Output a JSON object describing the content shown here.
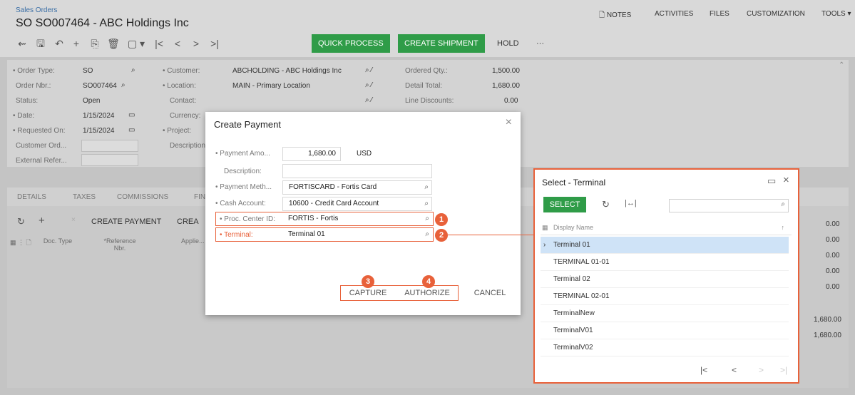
{
  "header": {
    "breadcrumb": "Sales Orders",
    "title": "SO SO007464 - ABC Holdings Inc",
    "nav": [
      "NOTES",
      "ACTIVITIES",
      "FILES",
      "CUSTOMIZATION",
      "TOOLS ▾"
    ],
    "toolbar_icons": [
      "back-icon",
      "save-icon",
      "undo-icon",
      "add-icon",
      "copy-icon",
      "delete-icon",
      "clipboard-icon",
      "first-icon",
      "prev-icon",
      "next-icon",
      "last-icon"
    ],
    "quick_process": "QUICK PROCESS",
    "create_shipment": "CREATE SHIPMENT",
    "hold": "HOLD",
    "more": "···"
  },
  "form": {
    "order_type_label": "Order Type:",
    "order_type": "SO",
    "order_nbr_label": "Order Nbr.:",
    "order_nbr": "SO007464",
    "status_label": "Status:",
    "status": "Open",
    "date_label": "Date:",
    "date": "1/15/2024",
    "requested_on_label": "Requested On:",
    "requested_on": "1/15/2024",
    "customer_ord_label": "Customer Ord...",
    "external_refer_label": "External Refer...",
    "customer_label": "Customer:",
    "customer": "ABCHOLDING - ABC Holdings Inc",
    "location_label": "Location:",
    "location": "MAIN - Primary Location",
    "contact_label": "Contact:",
    "currency_label": "Currency:",
    "project_label": "Project:",
    "description_label": "Description:",
    "ordered_qty_label": "Ordered Qty.:",
    "ordered_qty": "1,500.00",
    "detail_total_label": "Detail Total:",
    "detail_total": "1,680.00",
    "line_discounts_label": "Line Discounts:",
    "line_discounts": "0.00"
  },
  "tabs": [
    "DETAILS",
    "TAXES",
    "COMMISSIONS",
    "FIN"
  ],
  "grid": {
    "toolbar": {
      "create_payment": "CREATE PAYMENT",
      "crea": "CREA"
    },
    "columns": {
      "doc_type": "Doc. Type",
      "reference_nbr": "*Reference Nbr.",
      "applied": "Applie..."
    },
    "right_values": [
      "0.00",
      "0.00",
      "0.00",
      "0.00",
      "0.00",
      "1,680.00",
      "1,680.00"
    ]
  },
  "modal": {
    "title": "Create Payment",
    "payment_amount_label": "Payment Amo...",
    "payment_amount": "1,680.00",
    "currency": "USD",
    "description_label": "Description:",
    "payment_method_label": "Payment Meth...",
    "payment_method": "FORTISCARD - Fortis Card",
    "cash_account_label": "Cash Account:",
    "cash_account": "10600 - Credit Card Account",
    "proc_center_label": "Proc. Center ID:",
    "proc_center": "FORTIS - Fortis",
    "terminal_label": "Terminal:",
    "terminal": "Terminal 01",
    "capture": "CAPTURE",
    "authorize": "AUTHORIZE",
    "cancel": "CANCEL"
  },
  "badges": [
    "1",
    "2",
    "3",
    "4"
  ],
  "lookup": {
    "title": "Select - Terminal",
    "select": "SELECT",
    "column": "Display Name",
    "rows": [
      "Terminal 01",
      "TERMINAL 01-01",
      "Terminal 02",
      "TERMINAL 02-01",
      "TerminalNew",
      "TerminalV01",
      "TerminalV02"
    ]
  },
  "colors": {
    "accent_green": "#2f9c48",
    "callout_orange": "#e8613a",
    "selected_row": "#cfe3f7"
  }
}
